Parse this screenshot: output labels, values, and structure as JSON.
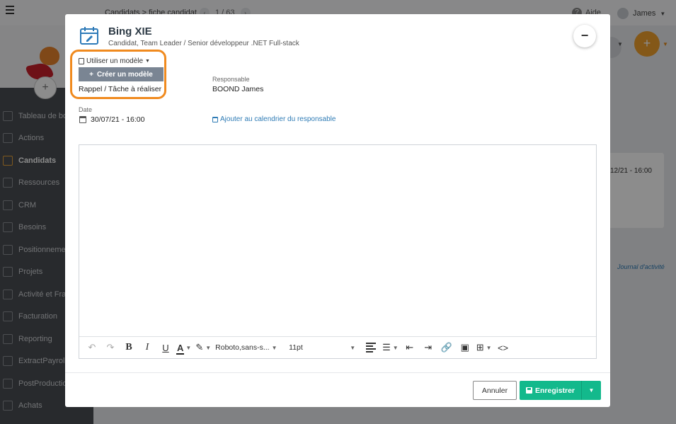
{
  "background": {
    "breadcrumb": "Candidats > fiche candidat",
    "pager": "1 / 63",
    "help_label": "Aide",
    "user_name": "James",
    "nav_items": [
      {
        "label": "Tableau de bord",
        "icon": "dashboard-icon"
      },
      {
        "label": "Actions",
        "icon": "calendar-icon"
      },
      {
        "label": "Candidats",
        "icon": "graduation-cap-icon",
        "active": true
      },
      {
        "label": "Ressources",
        "icon": "users-icon"
      },
      {
        "label": "CRM",
        "icon": "sitemap-icon"
      },
      {
        "label": "Besoins",
        "icon": "target-icon"
      },
      {
        "label": "Positionnements",
        "icon": "pin-icon"
      },
      {
        "label": "Projets",
        "icon": "briefcase-icon"
      },
      {
        "label": "Activité et Frais",
        "icon": "edit-icon"
      },
      {
        "label": "Facturation",
        "icon": "invoice-icon"
      },
      {
        "label": "Reporting",
        "icon": "chart-icon"
      },
      {
        "label": "ExtractPayroll",
        "icon": "file-icon"
      },
      {
        "label": "PostProduction",
        "icon": "file-icon"
      },
      {
        "label": "Achats",
        "icon": "cart-icon"
      }
    ],
    "card_date": "12/21 - 16:00",
    "journal_link": "Journal d'activité"
  },
  "modal": {
    "title": "Bing XIE",
    "subtitle": "Candidat, Team Leader / Senior développeur .NET Full-stack",
    "template_menu_label": "Utiliser un modèle",
    "create_template_label": "Créer un modèle",
    "reminder_type": "Rappel / Tâche à réaliser",
    "responsible_label": "Responsable",
    "responsible_value": "BOOND James",
    "date_label": "Date",
    "date_value": "30/07/21 - 16:00",
    "add_calendar_link": "Ajouter au calendrier du responsable",
    "editor": {
      "content": "",
      "font_family": "Roboto,sans-s...",
      "font_size": "11pt"
    },
    "cancel_label": "Annuler",
    "save_label": "Enregistrer",
    "highlight_color": "#f08a1e",
    "save_color": "#13b98c"
  }
}
